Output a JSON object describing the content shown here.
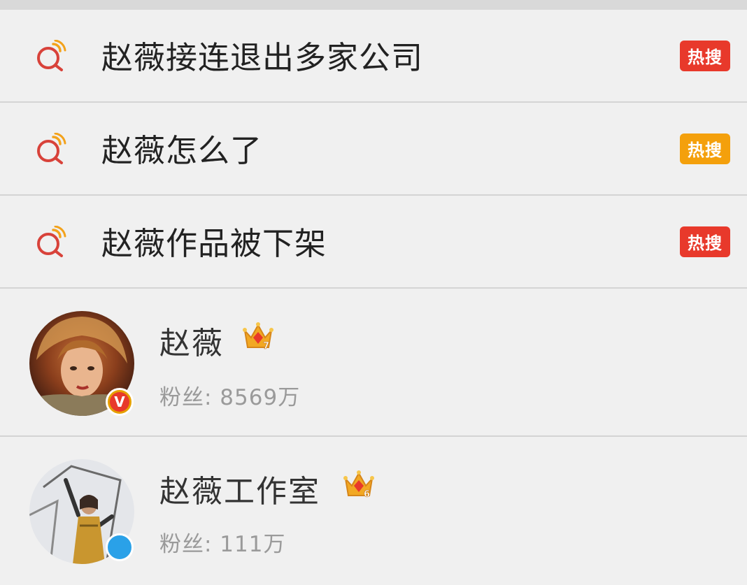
{
  "search_suggestions": [
    {
      "text": "赵薇接连退出多家公司",
      "badge": "热搜",
      "badge_color": "#e8392b"
    },
    {
      "text": "赵薇怎么了",
      "badge": "热搜",
      "badge_color": "#f4a00c"
    },
    {
      "text": "赵薇作品被下架",
      "badge": "热搜",
      "badge_color": "#e8392b"
    }
  ],
  "users": [
    {
      "name": "赵薇",
      "fans_label": "粉丝: 8569万",
      "level": "7",
      "verified_badge": "V",
      "verified_color": "#e6a000",
      "avatar": "illustrated-portrait"
    },
    {
      "name": "赵薇工作室",
      "fans_label": "粉丝: 111万",
      "level": "6",
      "verified_color": "#2aa1e8",
      "avatar": "illustrated-figure"
    }
  ],
  "colors": {
    "accent": "#e8392b",
    "icon_ring": "#d8423a",
    "icon_wave": "#f3a21b"
  }
}
